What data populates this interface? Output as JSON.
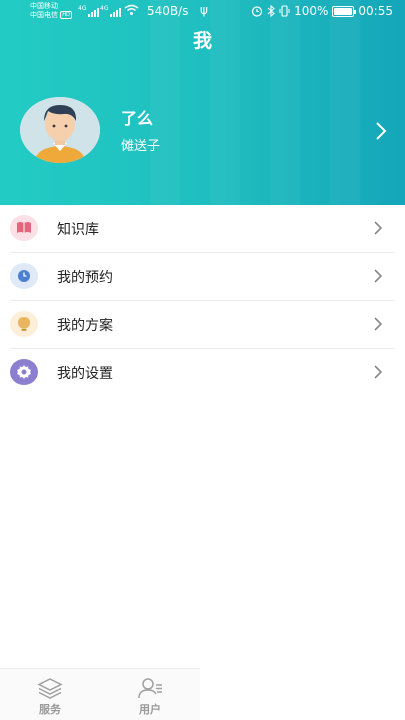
{
  "status_bar": {
    "carrier_1": "中国移动",
    "carrier_2": "中国电信",
    "hd_badge": "HD",
    "network_1": "4G",
    "network_2": "4G",
    "speed": "540B/s",
    "battery_text": "100%",
    "battery_level": 1.0,
    "time": "00:55",
    "icons": [
      "signal-icon",
      "wifi-icon",
      "usb-icon",
      "alarm-icon",
      "bluetooth-icon",
      "vibrate-icon",
      "battery-icon"
    ]
  },
  "header": {
    "title": "我",
    "colors": {
      "gradient_start": "#22ccc4",
      "gradient_end": "#14a6ba"
    }
  },
  "profile": {
    "name": "了么",
    "nickname": "傩送子",
    "avatar_icon": "user-avatar",
    "arrow_icon": "chevron-right-icon"
  },
  "menu": {
    "items": [
      {
        "label": "知识库",
        "icon": "book-icon",
        "icon_bg": "#fbe0e6",
        "icon_color": "#e2677c"
      },
      {
        "label": "我的预约",
        "icon": "clock-icon",
        "icon_bg": "#dfe9f8",
        "icon_color": "#4a7fd2"
      },
      {
        "label": "我的方案",
        "icon": "lightbulb-icon",
        "icon_bg": "#fbefd9",
        "icon_color": "#e8b660"
      },
      {
        "label": "我的设置",
        "icon": "gear-icon",
        "icon_bg": "#8c7fd0",
        "icon_color": "#ffffff"
      }
    ]
  },
  "tabbar": {
    "tabs": [
      {
        "label": "服务",
        "icon": "layers-icon"
      },
      {
        "label": "用户",
        "icon": "user-list-icon"
      }
    ]
  }
}
